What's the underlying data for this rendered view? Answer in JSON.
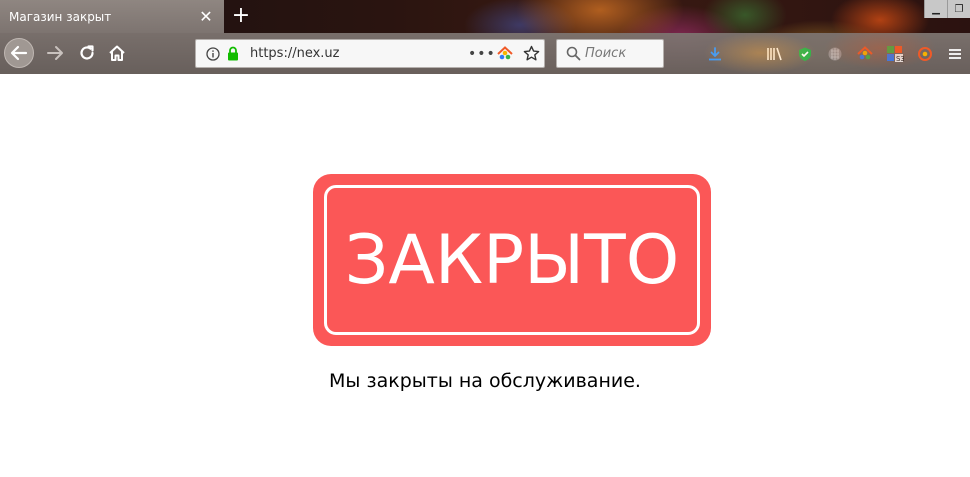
{
  "window": {
    "minimize_glyph": "▁",
    "restore_glyph": "❐"
  },
  "tab": {
    "title": "Магазин закрыт",
    "close_glyph": "✕",
    "new_tab_glyph": "+"
  },
  "nav": {
    "url": "https://nex.uz",
    "more_glyph": "•••",
    "search_placeholder": "Поиск"
  },
  "icons": {
    "back": "back-arrow-icon",
    "forward": "forward-arrow-icon",
    "reload": "reload-icon",
    "home": "home-icon",
    "info": "info-icon",
    "lock": "lock-icon",
    "bookmark": "star-icon",
    "search": "search-icon",
    "toolbar": [
      "download-icon",
      "library-icon",
      "shield-extension-icon",
      "grid-extension-icon",
      "house-extension-icon",
      "s3-extension-icon",
      "target-extension-icon",
      "menu-icon"
    ]
  },
  "colors": {
    "closed_box": "#fb5757",
    "lock_green": "#12bc00",
    "download_blue": "#3a9bff"
  },
  "page": {
    "closed_label": "ЗАКРЫТО",
    "message": "Мы закрыты на обслуживание."
  }
}
